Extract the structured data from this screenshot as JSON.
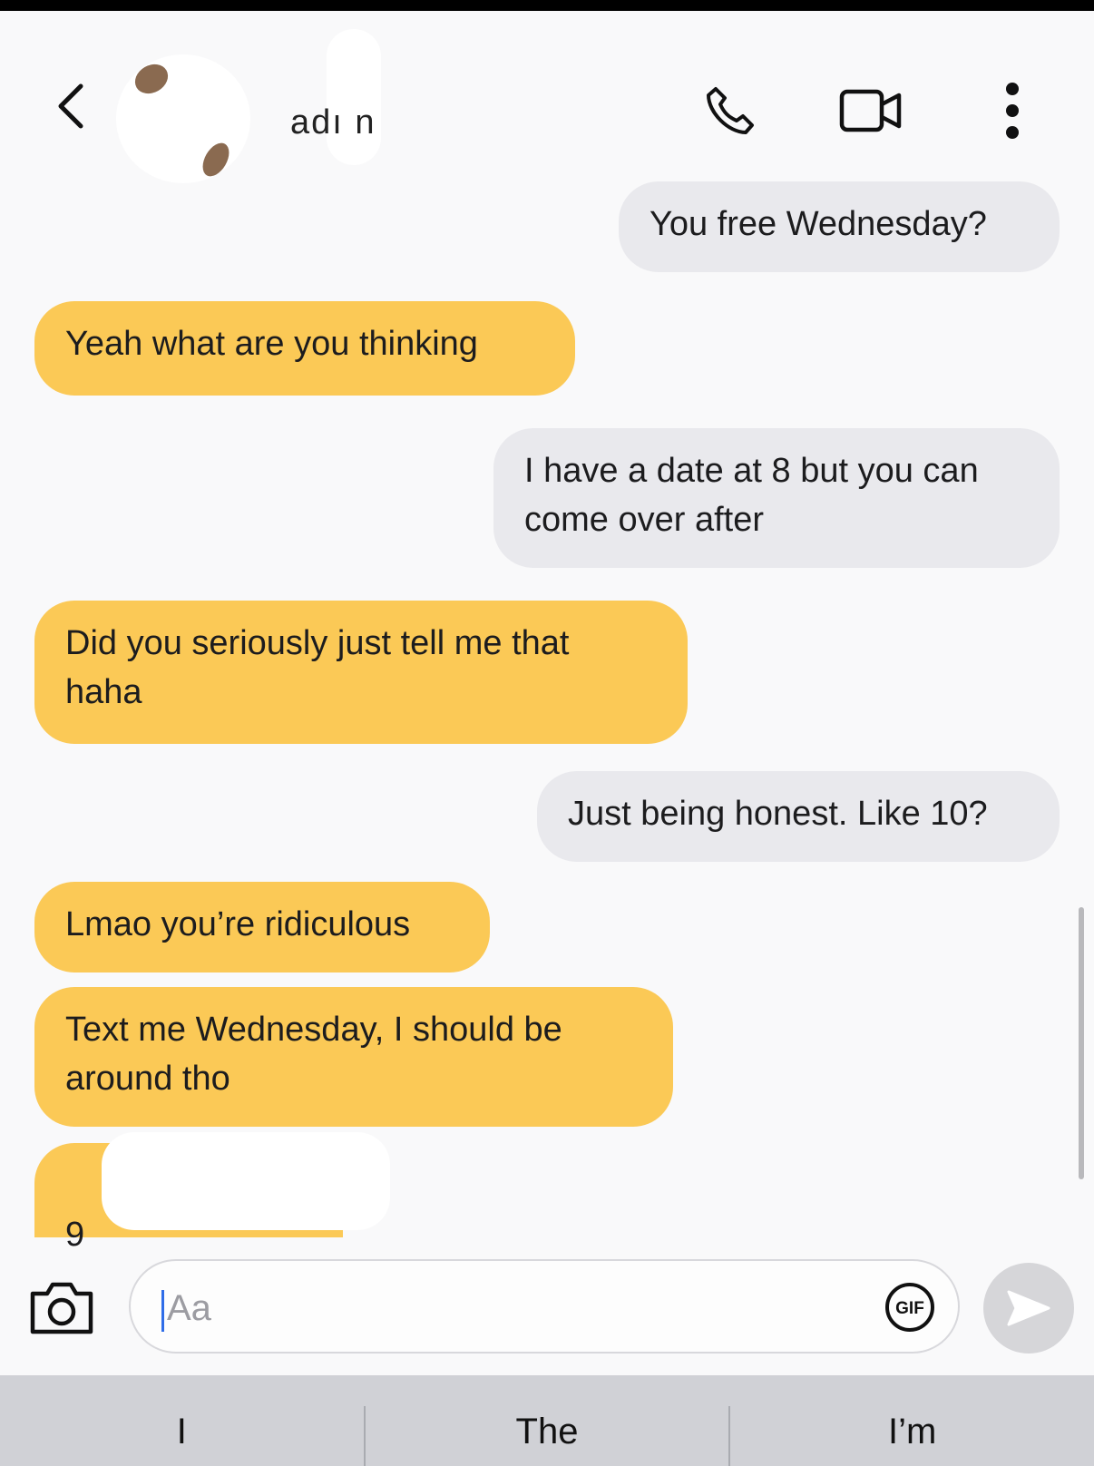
{
  "header": {
    "contact_name": "adı  n",
    "back_icon": "chevron-left-icon",
    "call_icon": "phone-icon",
    "video_icon": "video-camera-icon",
    "more_icon": "more-vertical-icon"
  },
  "messages": [
    {
      "direction": "outgoing",
      "text": "You free Wednesday?"
    },
    {
      "direction": "incoming",
      "text": "Yeah what are you thinking"
    },
    {
      "direction": "outgoing",
      "text": "I have a date at 8 but you can\ncome over after"
    },
    {
      "direction": "incoming",
      "text": "Did you seriously just tell me that\nhaha"
    },
    {
      "direction": "outgoing",
      "text": "Just being honest. Like 10?"
    },
    {
      "direction": "incoming",
      "text": "Lmao you’re ridiculous"
    },
    {
      "direction": "incoming",
      "text": "Text me Wednesday, I should be\naround tho"
    },
    {
      "direction": "incoming",
      "text": "9"
    }
  ],
  "composer": {
    "camera_icon": "camera-icon",
    "placeholder": "Aa",
    "gif_label": "GIF",
    "send_icon": "send-icon"
  },
  "suggestions": [
    "I",
    "The",
    "I’m"
  ],
  "colors": {
    "incoming_bubble": "#fbc956",
    "outgoing_bubble": "#e9e9ed",
    "background": "#f9f9fa"
  }
}
